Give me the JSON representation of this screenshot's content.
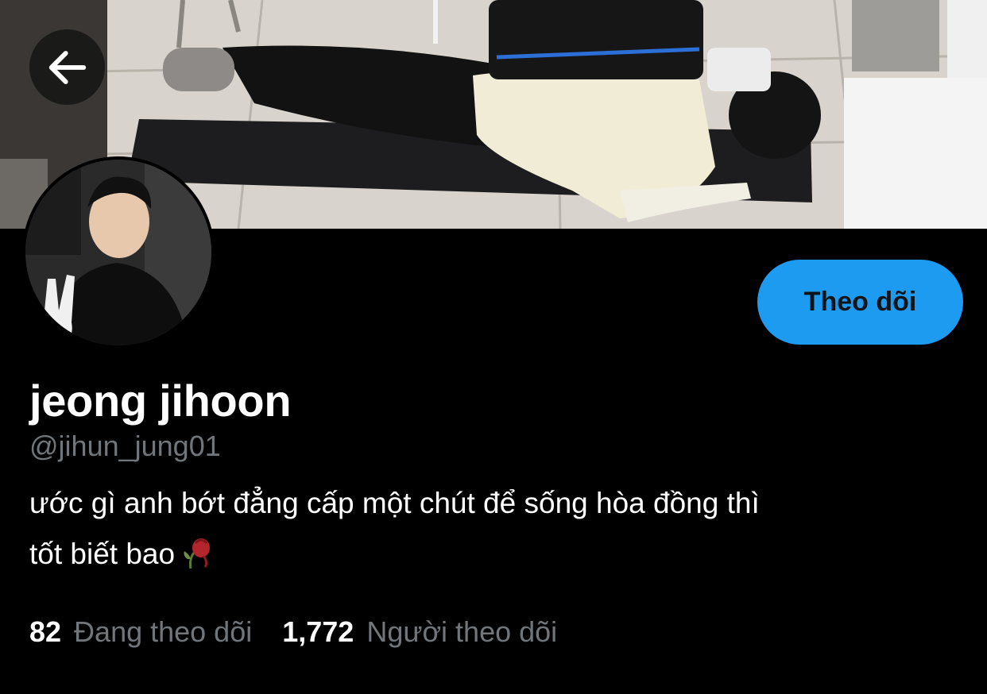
{
  "profile": {
    "display_name": "jeong jihoon",
    "handle": "@jihun_jung01",
    "bio_line1": "ước gì anh bớt đẳng cấp một chút để sống hòa đồng thì",
    "bio_line2": "tốt biết bao",
    "bio_emoji_icon": "wilted-rose-icon",
    "follow_label": "Theo dõi"
  },
  "stats": {
    "following_count": "82",
    "following_label": "Đang theo dõi",
    "followers_count": "1,772",
    "followers_label": "Người theo dõi"
  },
  "icons": {
    "back": "arrow-left-icon"
  },
  "colors": {
    "accent": "#1d9bf0",
    "secondary_text": "#71767b",
    "background": "#000000"
  }
}
